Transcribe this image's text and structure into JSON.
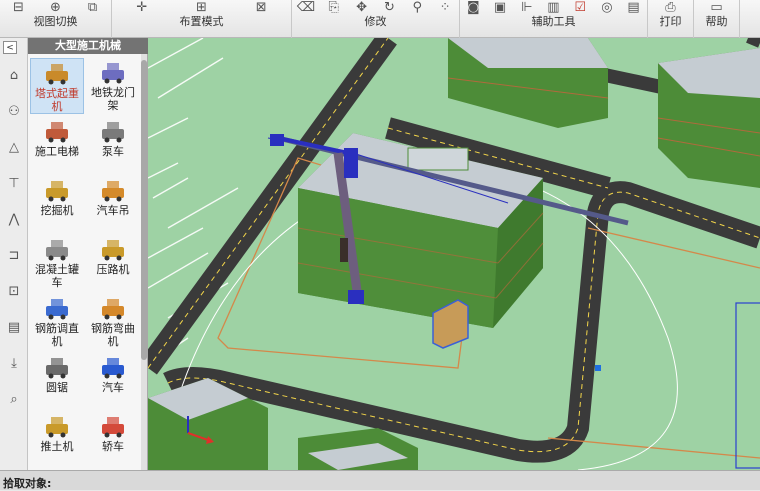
{
  "ribbon": {
    "groups": [
      {
        "label": "视图切换",
        "icons": [
          "view-3d-icon",
          "fullscreen-icon",
          "box-view-icon"
        ]
      },
      {
        "label": "布置模式",
        "icons": [
          "crosshair-icon",
          "grid-icon",
          "grid-dropdown-icon"
        ]
      },
      {
        "label": "修改",
        "icons": [
          "select-arrow-icon",
          "target-icon",
          "rotate-icon",
          "eraser-icon",
          "copy-icon",
          "move-icon",
          "redo-icon",
          "stamp-icon",
          "array-icon"
        ]
      },
      {
        "label": "辅助工具",
        "icons": [
          "camera-icon",
          "photo-icon",
          "measure-icon",
          "bar-chart-icon",
          "check-icon",
          "binoculars-icon",
          "report-icon"
        ]
      },
      {
        "label": "打印",
        "icons": [
          "printer-icon"
        ]
      },
      {
        "label": "帮助",
        "icons": [
          "help-icon"
        ]
      }
    ]
  },
  "panel": {
    "title": "大型施工机械",
    "items": [
      {
        "label": "塔式起重机",
        "icon": "tower-crane-icon",
        "selected": true
      },
      {
        "label": "地铁龙门架",
        "icon": "gantry-icon"
      },
      {
        "label": "施工电梯",
        "icon": "construction-elevator-icon"
      },
      {
        "label": "泵车",
        "icon": "pump-truck-icon"
      },
      {
        "label": "挖掘机",
        "icon": "excavator-icon"
      },
      {
        "label": "汽车吊",
        "icon": "truck-crane-icon"
      },
      {
        "label": "混凝土罐车",
        "icon": "concrete-mixer-icon"
      },
      {
        "label": "压路机",
        "icon": "road-roller-icon"
      },
      {
        "label": "钢筋调直机",
        "icon": "rebar-straightener-icon"
      },
      {
        "label": "钢筋弯曲机",
        "icon": "rebar-bender-icon"
      },
      {
        "label": "圆锯",
        "icon": "circular-saw-icon"
      },
      {
        "label": "汽车",
        "icon": "car-icon"
      },
      {
        "label": "推土机",
        "icon": "bulldozer-icon"
      },
      {
        "label": "轿车",
        "icon": "sedan-icon"
      }
    ]
  },
  "status": {
    "text": "拾取对象:"
  },
  "colors": {
    "accent": "#c0392b",
    "ground": "#9bd0a0",
    "building": "#4f8a3a",
    "roof": "#cfd4d8",
    "crane": "#2a2fbf"
  }
}
